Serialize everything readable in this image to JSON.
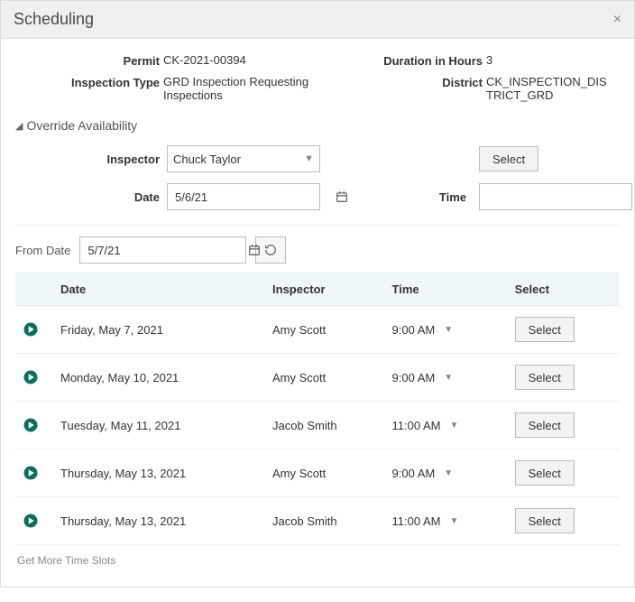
{
  "title": "Scheduling",
  "info": {
    "permit_label": "Permit",
    "permit_value": "CK-2021-00394",
    "duration_label": "Duration in Hours",
    "duration_value": "3",
    "type_label": "Inspection Type",
    "type_value": "GRD Inspection Requesting Inspections",
    "district_label": "District",
    "district_value": "CK_INSPECTION_DISTRICT_GRD"
  },
  "override_section_label": "Override Availability",
  "override": {
    "inspector_label": "Inspector",
    "inspector_value": "Chuck Taylor",
    "select_button": "Select",
    "date_label": "Date",
    "date_value": "5/6/21",
    "time_label": "Time",
    "time_value": ""
  },
  "fromdate": {
    "label": "From Date",
    "value": "5/7/21"
  },
  "table": {
    "headers": {
      "date": "Date",
      "inspector": "Inspector",
      "time": "Time",
      "select": "Select"
    },
    "select_button": "Select",
    "rows": [
      {
        "date": "Friday, May 7, 2021",
        "inspector": "Amy Scott",
        "time": "9:00 AM"
      },
      {
        "date": "Monday, May 10, 2021",
        "inspector": "Amy Scott",
        "time": "9:00 AM"
      },
      {
        "date": "Tuesday, May 11, 2021",
        "inspector": "Jacob Smith",
        "time": "11:00 AM"
      },
      {
        "date": "Thursday, May 13, 2021",
        "inspector": "Amy Scott",
        "time": "9:00 AM"
      },
      {
        "date": "Thursday, May 13, 2021",
        "inspector": "Jacob Smith",
        "time": "11:00 AM"
      }
    ]
  },
  "more_link": "Get More Time Slots"
}
